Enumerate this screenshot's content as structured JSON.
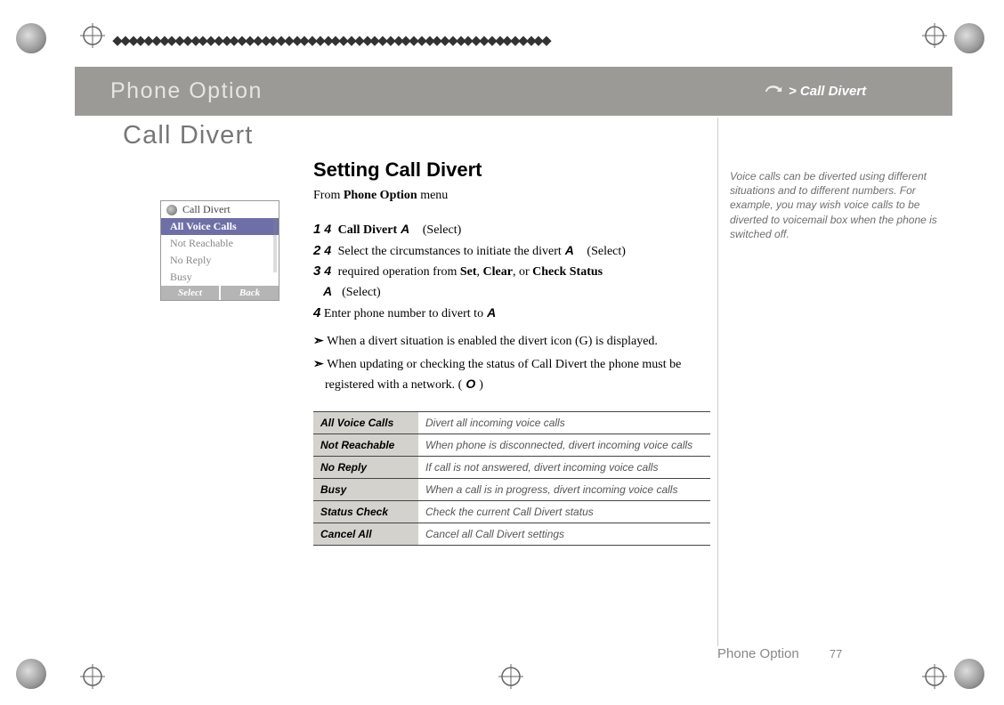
{
  "header": {
    "section_title": "Phone Option",
    "breadcrumb": "> Call Divert"
  },
  "page_title": "Call Divert",
  "section_heading": "Setting Call Divert",
  "from_line_prefix": "From ",
  "from_line_bold": "Phone Option",
  "from_line_suffix": " menu",
  "steps": {
    "s1_num": "1",
    "s1_glyph": "4",
    "s1_text_bold": "Call Divert",
    "s1_tail_glyph": "A",
    "s1_select": "(Select)",
    "s2_num": "2",
    "s2_glyph": "4",
    "s2_text": "Select the circumstances to initiate the divert",
    "s2_tail_glyph": "A",
    "s2_select": "(Select)",
    "s3_num": "3",
    "s3_glyph": "4",
    "s3_text_pre": "required operation from ",
    "s3_b1": "Set",
    "s3_sep1": ", ",
    "s3_b2": "Clear",
    "s3_sep2": ", or ",
    "s3_b3": "Check Status",
    "s3_tail_glyph": "A",
    "s3_select": "(Select)",
    "s4_num": "4",
    "s4_text": " Enter phone number to divert to",
    "s4_tail_glyph": "A"
  },
  "notes": {
    "n1": "When a divert situation is enabled the divert icon (G) is displayed.",
    "n2_pre": "When updating or checking the status of Call Divert the phone must be registered with a network. (",
    "n2_glyph": "O",
    "n2_post": ")"
  },
  "table": [
    {
      "k": "All Voice Calls",
      "v": "Divert all incoming voice calls"
    },
    {
      "k": "Not Reachable",
      "v": "When phone is disconnected, divert incoming voice calls"
    },
    {
      "k": "No Reply",
      "v": "If call is not answered, divert incoming voice calls"
    },
    {
      "k": "Busy",
      "v": "When a call is in progress, divert incoming voice calls"
    },
    {
      "k": "Status Check",
      "v": "Check the current Call Divert status"
    },
    {
      "k": "Cancel All",
      "v": "Cancel all Call Divert settings"
    }
  ],
  "side_note": "Voice calls can be diverted using different situations and to different numbers. For example, you may wish voice calls to be diverted to voicemail box when the phone is switched off.",
  "phone_screenshot": {
    "title": "Call Divert",
    "items": [
      "All Voice Calls",
      "Not Reachable",
      "No Reply",
      "Busy"
    ],
    "softkeys": {
      "left": "Select",
      "right": "Back"
    }
  },
  "footer": {
    "section": "Phone Option",
    "page": "77"
  }
}
